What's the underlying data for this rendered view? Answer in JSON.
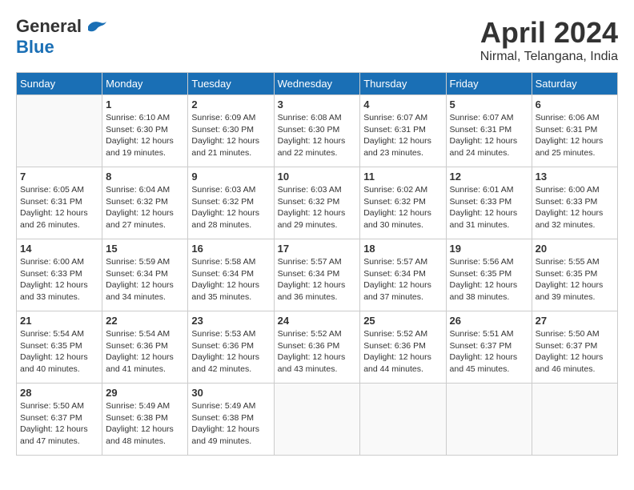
{
  "header": {
    "logo": {
      "general": "General",
      "blue": "Blue"
    },
    "title": "April 2024",
    "location": "Nirmal, Telangana, India"
  },
  "calendar": {
    "days_of_week": [
      "Sunday",
      "Monday",
      "Tuesday",
      "Wednesday",
      "Thursday",
      "Friday",
      "Saturday"
    ],
    "weeks": [
      [
        {
          "day": "",
          "info": ""
        },
        {
          "day": "1",
          "info": "Sunrise: 6:10 AM\nSunset: 6:30 PM\nDaylight: 12 hours\nand 19 minutes."
        },
        {
          "day": "2",
          "info": "Sunrise: 6:09 AM\nSunset: 6:30 PM\nDaylight: 12 hours\nand 21 minutes."
        },
        {
          "day": "3",
          "info": "Sunrise: 6:08 AM\nSunset: 6:30 PM\nDaylight: 12 hours\nand 22 minutes."
        },
        {
          "day": "4",
          "info": "Sunrise: 6:07 AM\nSunset: 6:31 PM\nDaylight: 12 hours\nand 23 minutes."
        },
        {
          "day": "5",
          "info": "Sunrise: 6:07 AM\nSunset: 6:31 PM\nDaylight: 12 hours\nand 24 minutes."
        },
        {
          "day": "6",
          "info": "Sunrise: 6:06 AM\nSunset: 6:31 PM\nDaylight: 12 hours\nand 25 minutes."
        }
      ],
      [
        {
          "day": "7",
          "info": "Sunrise: 6:05 AM\nSunset: 6:31 PM\nDaylight: 12 hours\nand 26 minutes."
        },
        {
          "day": "8",
          "info": "Sunrise: 6:04 AM\nSunset: 6:32 PM\nDaylight: 12 hours\nand 27 minutes."
        },
        {
          "day": "9",
          "info": "Sunrise: 6:03 AM\nSunset: 6:32 PM\nDaylight: 12 hours\nand 28 minutes."
        },
        {
          "day": "10",
          "info": "Sunrise: 6:03 AM\nSunset: 6:32 PM\nDaylight: 12 hours\nand 29 minutes."
        },
        {
          "day": "11",
          "info": "Sunrise: 6:02 AM\nSunset: 6:32 PM\nDaylight: 12 hours\nand 30 minutes."
        },
        {
          "day": "12",
          "info": "Sunrise: 6:01 AM\nSunset: 6:33 PM\nDaylight: 12 hours\nand 31 minutes."
        },
        {
          "day": "13",
          "info": "Sunrise: 6:00 AM\nSunset: 6:33 PM\nDaylight: 12 hours\nand 32 minutes."
        }
      ],
      [
        {
          "day": "14",
          "info": "Sunrise: 6:00 AM\nSunset: 6:33 PM\nDaylight: 12 hours\nand 33 minutes."
        },
        {
          "day": "15",
          "info": "Sunrise: 5:59 AM\nSunset: 6:34 PM\nDaylight: 12 hours\nand 34 minutes."
        },
        {
          "day": "16",
          "info": "Sunrise: 5:58 AM\nSunset: 6:34 PM\nDaylight: 12 hours\nand 35 minutes."
        },
        {
          "day": "17",
          "info": "Sunrise: 5:57 AM\nSunset: 6:34 PM\nDaylight: 12 hours\nand 36 minutes."
        },
        {
          "day": "18",
          "info": "Sunrise: 5:57 AM\nSunset: 6:34 PM\nDaylight: 12 hours\nand 37 minutes."
        },
        {
          "day": "19",
          "info": "Sunrise: 5:56 AM\nSunset: 6:35 PM\nDaylight: 12 hours\nand 38 minutes."
        },
        {
          "day": "20",
          "info": "Sunrise: 5:55 AM\nSunset: 6:35 PM\nDaylight: 12 hours\nand 39 minutes."
        }
      ],
      [
        {
          "day": "21",
          "info": "Sunrise: 5:54 AM\nSunset: 6:35 PM\nDaylight: 12 hours\nand 40 minutes."
        },
        {
          "day": "22",
          "info": "Sunrise: 5:54 AM\nSunset: 6:36 PM\nDaylight: 12 hours\nand 41 minutes."
        },
        {
          "day": "23",
          "info": "Sunrise: 5:53 AM\nSunset: 6:36 PM\nDaylight: 12 hours\nand 42 minutes."
        },
        {
          "day": "24",
          "info": "Sunrise: 5:52 AM\nSunset: 6:36 PM\nDaylight: 12 hours\nand 43 minutes."
        },
        {
          "day": "25",
          "info": "Sunrise: 5:52 AM\nSunset: 6:36 PM\nDaylight: 12 hours\nand 44 minutes."
        },
        {
          "day": "26",
          "info": "Sunrise: 5:51 AM\nSunset: 6:37 PM\nDaylight: 12 hours\nand 45 minutes."
        },
        {
          "day": "27",
          "info": "Sunrise: 5:50 AM\nSunset: 6:37 PM\nDaylight: 12 hours\nand 46 minutes."
        }
      ],
      [
        {
          "day": "28",
          "info": "Sunrise: 5:50 AM\nSunset: 6:37 PM\nDaylight: 12 hours\nand 47 minutes."
        },
        {
          "day": "29",
          "info": "Sunrise: 5:49 AM\nSunset: 6:38 PM\nDaylight: 12 hours\nand 48 minutes."
        },
        {
          "day": "30",
          "info": "Sunrise: 5:49 AM\nSunset: 6:38 PM\nDaylight: 12 hours\nand 49 minutes."
        },
        {
          "day": "",
          "info": ""
        },
        {
          "day": "",
          "info": ""
        },
        {
          "day": "",
          "info": ""
        },
        {
          "day": "",
          "info": ""
        }
      ]
    ]
  }
}
